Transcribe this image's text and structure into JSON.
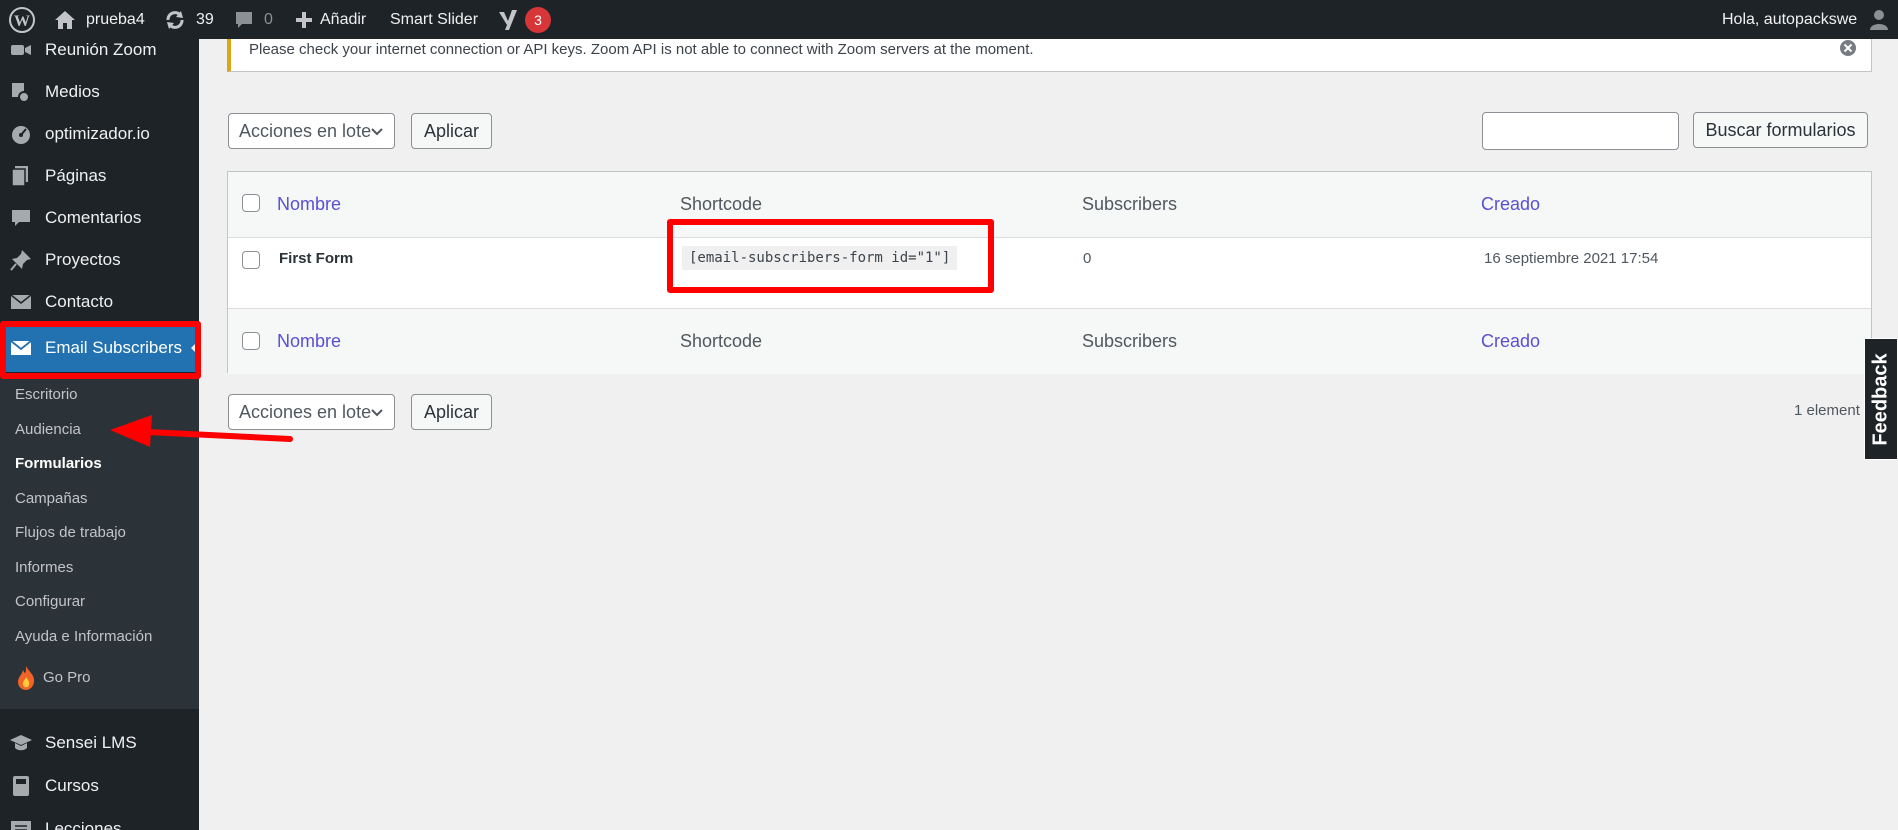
{
  "adminbar": {
    "site_name": "prueba4",
    "updates_count": "39",
    "comments_count": "0",
    "add_new_label": "Añadir",
    "smart_slider_label": "Smart Slider",
    "yoast_badge": "3",
    "greeting": "Hola, autopackswe"
  },
  "sidebar": {
    "items": [
      {
        "label": "Reunión Zoom",
        "icon": "video-icon"
      },
      {
        "label": "Medios",
        "icon": "media-icon"
      },
      {
        "label": "optimizador.io",
        "icon": "gauge-icon"
      },
      {
        "label": "Páginas",
        "icon": "pages-icon"
      },
      {
        "label": "Comentarios",
        "icon": "comment-icon"
      },
      {
        "label": "Proyectos",
        "icon": "pin-icon"
      },
      {
        "label": "Contacto",
        "icon": "mail-icon"
      },
      {
        "label": "Email Subscribers",
        "icon": "envelope-icon"
      }
    ],
    "submenu": [
      {
        "label": "Escritorio"
      },
      {
        "label": "Audiencia"
      },
      {
        "label": "Formularios"
      },
      {
        "label": "Campañas"
      },
      {
        "label": "Flujos de trabajo"
      },
      {
        "label": "Informes"
      },
      {
        "label": "Configurar"
      },
      {
        "label": "Ayuda e Información"
      },
      {
        "label": "Go Pro"
      }
    ],
    "items_after": [
      {
        "label": "Sensei LMS",
        "icon": "mortarboard-icon"
      },
      {
        "label": "Cursos",
        "icon": "book-icon"
      },
      {
        "label": "Lecciones",
        "icon": "list-icon"
      }
    ]
  },
  "notice": {
    "text": "Please check your internet connection or API keys. Zoom API is not able to connect with Zoom servers at the moment."
  },
  "bulk_top": {
    "select_value": "Acciones en lote",
    "apply_label": "Aplicar"
  },
  "search": {
    "value": "",
    "button_label": "Buscar formularios"
  },
  "table": {
    "columns": [
      "Nombre",
      "Shortcode",
      "Subscribers",
      "Creado"
    ],
    "rows": [
      {
        "name": "First Form",
        "shortcode": "[email-subscribers-form id=\"1\"]",
        "subscribers": "0",
        "created": "16 septiembre 2021 17:54"
      }
    ]
  },
  "bulk_bottom": {
    "select_value": "Acciones en lote",
    "apply_label": "Aplicar"
  },
  "items_count": "1 element",
  "feedback_label": "Feedback",
  "colors": {
    "accent": "#2271b1",
    "annotation": "#ff0000",
    "link": "#5b4fd1"
  }
}
